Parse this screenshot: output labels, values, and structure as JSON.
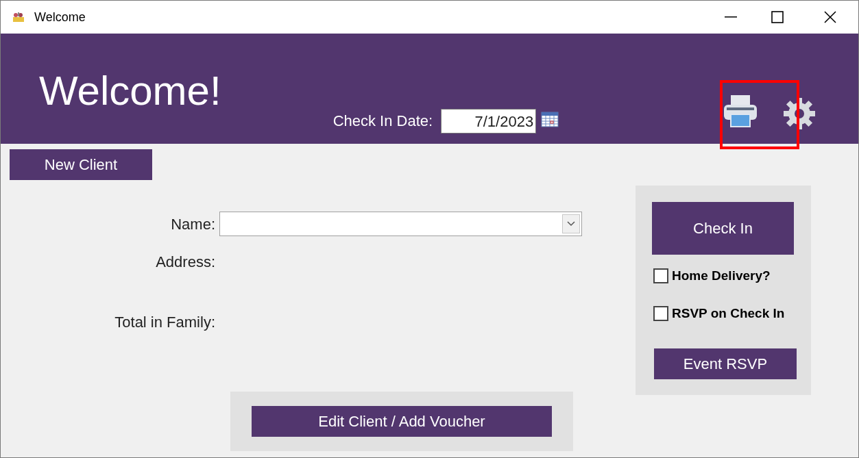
{
  "window": {
    "title": "Welcome"
  },
  "header": {
    "heading": "Welcome!",
    "check_in_date_label": "Check In Date:",
    "check_in_date": "7/1/2023",
    "printer_highlighted": true
  },
  "new_client_button": "New Client",
  "form": [
    {
      "label": "Name:",
      "kind": "combo"
    },
    {
      "label": "Address:",
      "kind": "text"
    },
    {
      "label": "Total in Family:",
      "kind": "text"
    }
  ],
  "edit_button": "Edit Client / Add Voucher",
  "check_in_panel": {
    "check_in_button": "Check In",
    "options": [
      {
        "label": "Home Delivery?",
        "checked": false
      },
      {
        "label": "RSVP on Check In",
        "checked": false
      }
    ],
    "event_rsvp_button": "Event RSVP"
  }
}
